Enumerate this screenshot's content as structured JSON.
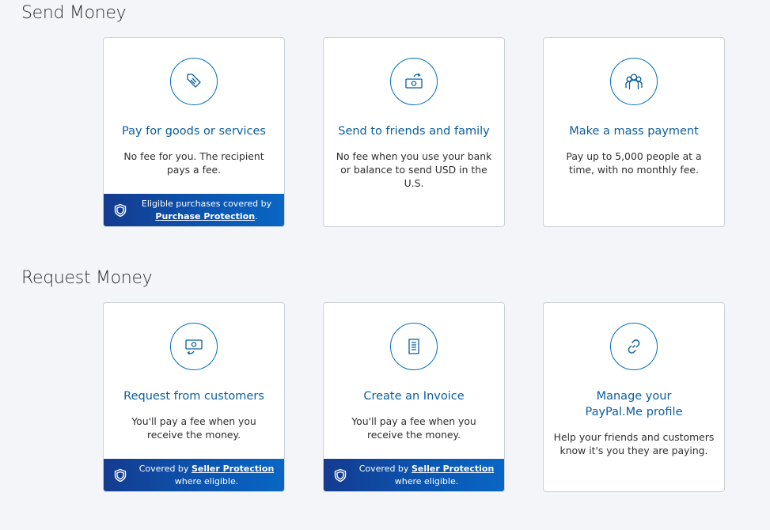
{
  "send_section": {
    "title": "Send Money",
    "cards": [
      {
        "icon": "goods-tag-icon",
        "title": "Pay for goods or services",
        "desc": "No fee for you. The recipient pays a fee.",
        "banner": {
          "pre": "Eligible purchases covered by",
          "link": "Purchase Protection",
          "post": "."
        }
      },
      {
        "icon": "send-cash-icon",
        "title": "Send to friends and family",
        "desc": "No fee when you use your bank or balance to send USD in the U.S."
      },
      {
        "icon": "people-group-icon",
        "title": "Make a mass payment",
        "desc": "Pay up to 5,000 people at a time, with no monthly fee."
      }
    ]
  },
  "request_section": {
    "title": "Request Money",
    "cards": [
      {
        "icon": "request-cash-icon",
        "title": "Request from customers",
        "desc": "You'll pay a fee when you receive the money.",
        "banner": {
          "pre": "Covered by",
          "link": "Seller Protection",
          "post": "where eligible."
        }
      },
      {
        "icon": "invoice-icon",
        "title": "Create an Invoice",
        "desc": "You'll pay a fee when you receive the money.",
        "banner": {
          "pre": "Covered by",
          "link": "Seller Protection",
          "post": "where eligible."
        }
      },
      {
        "icon": "link-icon",
        "title": "Manage your PayPal.Me profile",
        "desc": "Help your friends and customers know it's you they are paying."
      }
    ]
  },
  "colors": {
    "accent": "#0070ba",
    "title_blue": "#0a5d9c",
    "banner_start": "#143b8f",
    "banner_end": "#0a66c4",
    "background": "#f4f5f8"
  }
}
